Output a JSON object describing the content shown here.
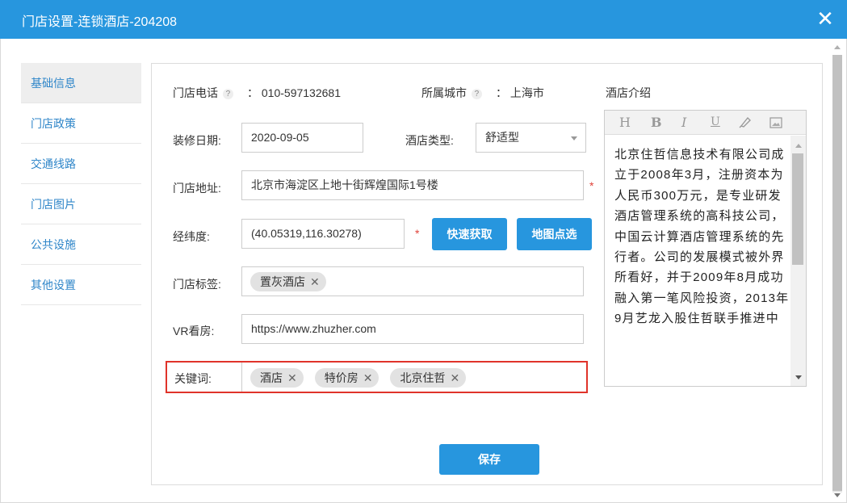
{
  "window": {
    "title": "门店设置-连锁酒店-204208",
    "close_glyph": "✕"
  },
  "sidebar": {
    "items": [
      {
        "label": "基础信息",
        "active": true
      },
      {
        "label": "门店政策"
      },
      {
        "label": "交通线路"
      },
      {
        "label": "门店图片"
      },
      {
        "label": "公共设施"
      },
      {
        "label": "其他设置"
      }
    ]
  },
  "form": {
    "phone_label": "门店电话",
    "phone_value": "：  010-597132681",
    "city_label": "所属城市",
    "city_value": "：  上海市",
    "help_glyph": "?",
    "renovation_label": "装修日期:",
    "renovation_value": "2020-09-05",
    "hotel_type_label": "酒店类型:",
    "hotel_type_value": "舒适型",
    "address_label": "门店地址:",
    "address_value": "北京市海淀区上地十街辉煌国际1号楼",
    "coords_label": "经纬度:",
    "coords_value": "(40.05319,116.30278)",
    "required_mark": "*",
    "quick_fetch_button": "快速获取",
    "map_pick_button": "地图点选",
    "store_tags_label": "门店标签:",
    "store_tags": [
      "置灰酒店"
    ],
    "vr_label": "VR看房:",
    "vr_value": "https://www.zhuzher.com",
    "keywords_label": "关键词:",
    "keywords": [
      "酒店",
      "特价房",
      "北京住哲"
    ],
    "tag_remove_glyph": "✕",
    "save_button": "保存"
  },
  "intro": {
    "label": "酒店介绍",
    "toolbar": [
      "H",
      "B",
      "I",
      "U",
      "eraser-icon",
      "image-icon"
    ],
    "text": "北京住哲信息技术有限公司成立于2008年3月，注册资本为人民币300万元，是专业研发酒店管理系统的高科技公司，中国云计算酒店管理系统的先行者。公司的发展模式被外界所看好，并于2009年8月成功融入第一笔风险投资，2013年9月艺龙入股住哲联手推进中"
  },
  "colors": {
    "primary": "#2796de",
    "link": "#2f86c9",
    "required": "#e0433a",
    "highlight": "#e0332a"
  }
}
